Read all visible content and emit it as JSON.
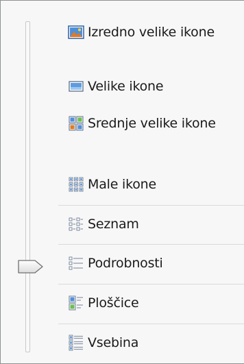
{
  "menu": {
    "items": [
      {
        "label": "Izredno velike ikone",
        "icon": "extra-large-icons-icon"
      },
      {
        "label": "Velike ikone",
        "icon": "large-icons-icon"
      },
      {
        "label": "Srednje velike ikone",
        "icon": "medium-icons-icon"
      },
      {
        "label": "Male ikone",
        "icon": "small-icons-icon"
      },
      {
        "label": "Seznam",
        "icon": "list-icon"
      },
      {
        "label": "Podrobnosti",
        "icon": "details-icon"
      },
      {
        "label": "Ploščice",
        "icon": "tiles-icon"
      },
      {
        "label": "Vsebina",
        "icon": "content-icon"
      }
    ],
    "slider_selected": "Podrobnosti"
  },
  "colors": {
    "background": "#f7f7f7",
    "border": "#8e8f8f",
    "separator": "#dadada",
    "text": "#1a1a1a",
    "icon_blue": "#3a7bd5"
  }
}
